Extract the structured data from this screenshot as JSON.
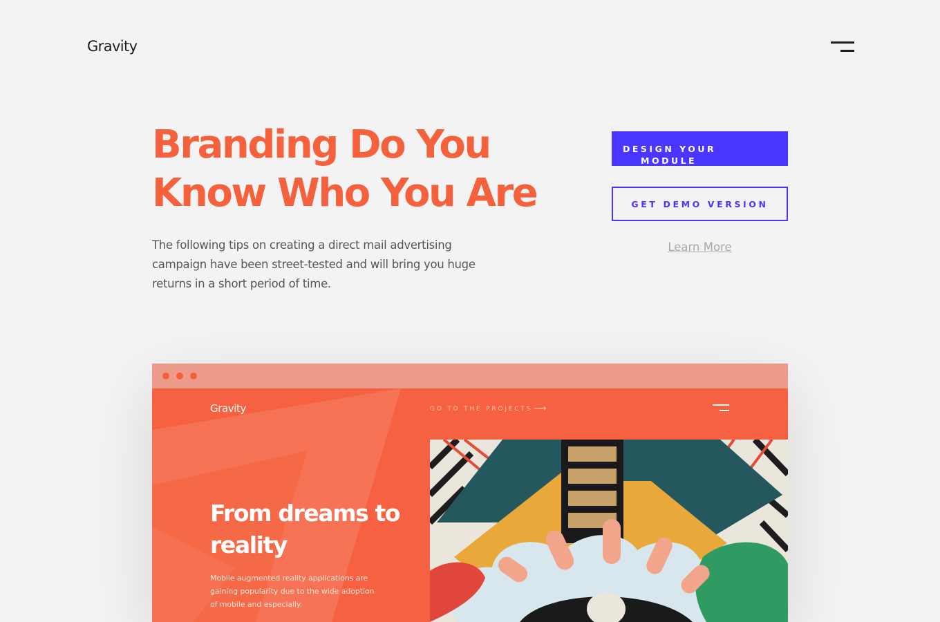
{
  "header": {
    "logo": "Gravity",
    "menu_icon": "hamburger-menu-icon"
  },
  "hero": {
    "title": "Branding Do You Know Who You Are",
    "description": "The following tips on creating a direct mail advertising campaign have been street-tested and will bring you huge returns in a short period of time."
  },
  "actions": {
    "primary_label_line1": "DESIGN YOUR",
    "primary_label_line2": "MODULE",
    "secondary_label": "GET DEMO VERSION",
    "link_label": "Learn More"
  },
  "preview": {
    "logo": "Gravity",
    "nav_link": "GO TO THE PROJECTS",
    "nav_arrow_icon": "arrow-right-icon",
    "title": "From dreams to reality",
    "description": "Mobile augmented reality applications are gaining popularity due to the wide adoption of mobile and especially."
  },
  "colors": {
    "accent": "#f5613d",
    "primary_button": "#4b36ff",
    "background": "#f3f3f3",
    "browser_bar": "#ec9b8a"
  }
}
